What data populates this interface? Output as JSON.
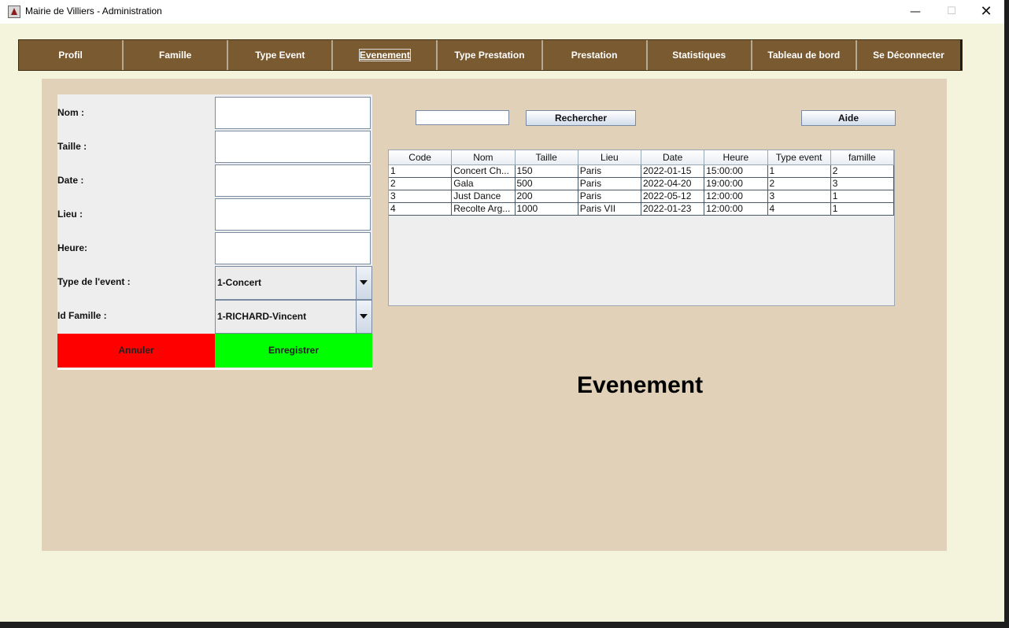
{
  "window": {
    "title": "Mairie de Villiers - Administration",
    "min_symbol": "—",
    "max_symbol": "☐",
    "close_symbol": "✕"
  },
  "nav": {
    "items": [
      {
        "label": "Profil"
      },
      {
        "label": "Famille"
      },
      {
        "label": "Type Event"
      },
      {
        "label": "Evenement",
        "active": true
      },
      {
        "label": "Type Prestation"
      },
      {
        "label": "Prestation"
      },
      {
        "label": "Statistiques"
      },
      {
        "label": "Tableau de bord"
      },
      {
        "label": "Se Déconnecter"
      }
    ]
  },
  "form": {
    "fields": [
      {
        "label": "Nom  :",
        "value": ""
      },
      {
        "label": "Taille  :",
        "value": ""
      },
      {
        "label": "Date :",
        "value": ""
      },
      {
        "label": "Lieu :",
        "value": ""
      },
      {
        "label": "Heure:",
        "value": ""
      }
    ],
    "type_event": {
      "label": "Type de l'event :",
      "selected": "1-Concert"
    },
    "id_famille": {
      "label": "Id Famille :",
      "selected": "1-RICHARD-Vincent"
    },
    "cancel_label": "Annuler",
    "save_label": "Enregistrer"
  },
  "search": {
    "value": "",
    "button_label": "Rechercher",
    "help_label": "Aide"
  },
  "table": {
    "columns": [
      "Code",
      "Nom",
      "Taille",
      "Lieu",
      "Date",
      "Heure",
      "Type event",
      "famille"
    ],
    "rows": [
      [
        "1",
        "Concert Ch...",
        "150",
        "Paris",
        "2022-01-15",
        "15:00:00",
        "1",
        "2"
      ],
      [
        "2",
        "Gala",
        "500",
        "Paris",
        "2022-04-20",
        "19:00:00",
        "2",
        "3"
      ],
      [
        "3",
        "Just Dance",
        "200",
        "Paris",
        "2022-05-12",
        "12:00:00",
        "3",
        "1"
      ],
      [
        "4",
        "Recolte Arg...",
        "1000",
        "Paris VII",
        "2022-01-23",
        "12:00:00",
        "4",
        "1"
      ]
    ]
  },
  "page_title": "Evenement",
  "colors": {
    "nav_bg": "#7a5a30",
    "panel_bg": "#e0d1b8",
    "window_bg": "#f4f3dc",
    "cancel_bg": "#ff0000",
    "save_bg": "#00ff00"
  }
}
